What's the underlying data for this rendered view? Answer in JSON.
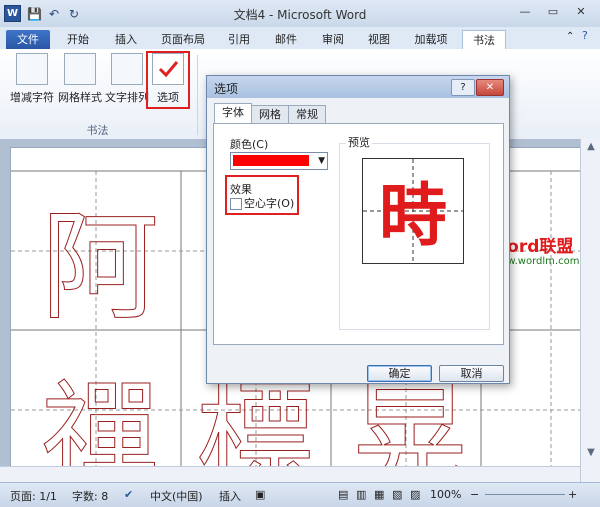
{
  "window": {
    "title": "文档4 - Microsoft Word"
  },
  "qat": {
    "logo": "W",
    "save": "💾",
    "undo": "↶",
    "redo": "↻"
  },
  "tabs": [
    {
      "label": "文件"
    },
    {
      "label": "开始"
    },
    {
      "label": "插入"
    },
    {
      "label": "页面布局"
    },
    {
      "label": "引用"
    },
    {
      "label": "邮件"
    },
    {
      "label": "审阅"
    },
    {
      "label": "视图"
    },
    {
      "label": "加载项"
    },
    {
      "label": "书法"
    }
  ],
  "ribbon": {
    "buttons": [
      {
        "label": "增减字符"
      },
      {
        "label": "网格样式"
      },
      {
        "label": "文字排列"
      },
      {
        "label": "选项"
      }
    ],
    "group_label": "书法"
  },
  "document": {
    "chars": [
      "阿",
      "禪",
      "標",
      "晃"
    ]
  },
  "dialog": {
    "title": "选项",
    "help": "?",
    "close": "✕",
    "tabs": [
      {
        "label": "字体"
      },
      {
        "label": "网格"
      },
      {
        "label": "常规"
      }
    ],
    "color_label": "颜色(C)",
    "color_value": "#ff0000",
    "effects_label": "效果",
    "hollow_label": "空心字(O)",
    "preview_label": "预览",
    "preview_char": "時",
    "ok": "确定",
    "cancel": "取消"
  },
  "watermark": {
    "brand": "Word联盟",
    "url": "www.wordlm.com"
  },
  "status": {
    "page": "页面: 1/1",
    "words": "字数: 8",
    "lang": "中文(中国)",
    "mode": "插入",
    "zoom": "100%"
  }
}
